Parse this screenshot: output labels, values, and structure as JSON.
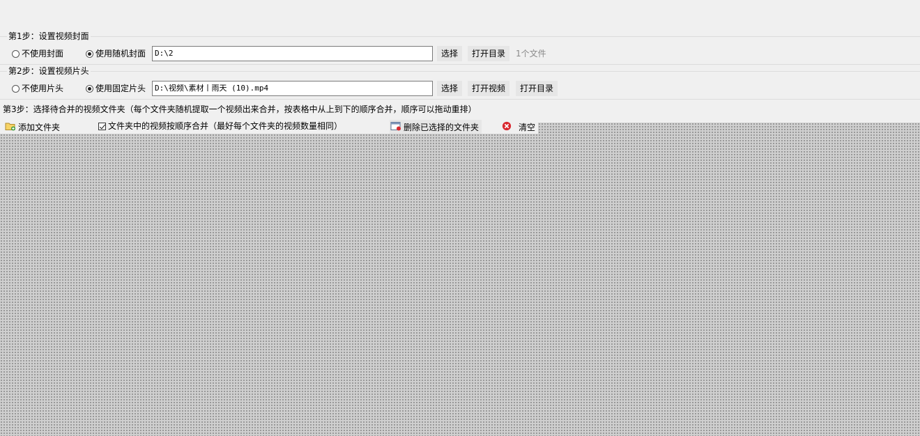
{
  "step1": {
    "legend": "第1步：设置视频封面",
    "radio_none": "不使用封面",
    "radio_random": "使用随机封面",
    "path_value": "D:\\2",
    "select_label": "选择",
    "open_dir_label": "打开目录",
    "file_count": "1个文件"
  },
  "step2": {
    "legend": "第2步：设置视频片头",
    "radio_none": "不使用片头",
    "radio_fixed": "使用固定片头",
    "path_value": "D:\\视频\\素材丨雨天 (10).mp4",
    "select_label": "选择",
    "open_video_label": "打开视频",
    "open_dir_label": "打开目录"
  },
  "step3": {
    "label": "第3步：选择待合并的视频文件夹（每个文件夹随机提取一个视频出来合并，按表格中从上到下的顺序合并，顺序可以拖动重排）"
  },
  "toolbar": {
    "add_folder": "添加文件夹",
    "order_checkbox": "文件夹中的视频按顺序合并（最好每个文件夹的视频数量相同）",
    "delete_selected": "删除已选择的文件夹",
    "clear": "清空"
  },
  "colors": {
    "window_bg": "#f0f0f0",
    "grid_bg": "#cfcfcf",
    "clear_icon_red": "#d9282f"
  },
  "icons": {
    "add_folder": "folder-add-icon",
    "delete": "delete-window-icon",
    "clear": "red-x-circle-icon"
  }
}
